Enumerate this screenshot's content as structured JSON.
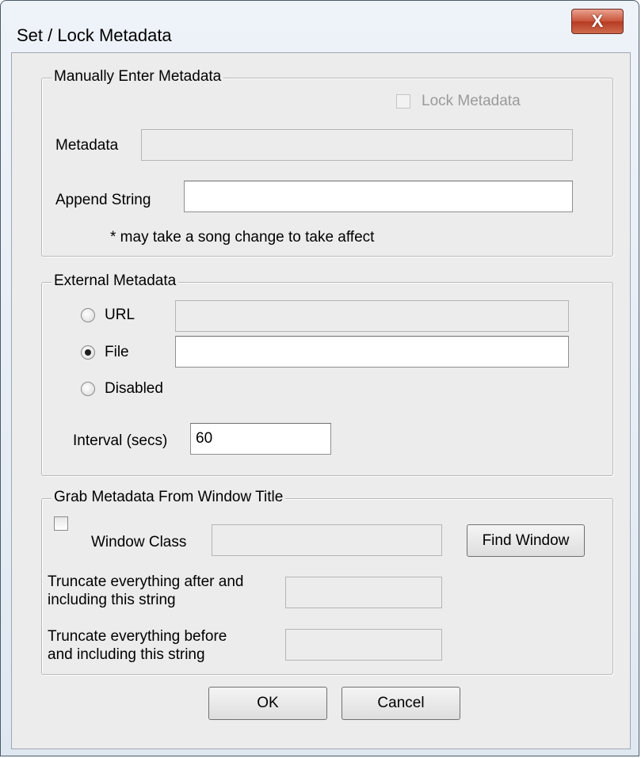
{
  "window": {
    "title": "Set / Lock Metadata",
    "close_glyph": "X"
  },
  "manual": {
    "legend": "Manually Enter Metadata",
    "lock_label": "Lock Metadata",
    "lock_checked": false,
    "lock_enabled": false,
    "metadata_label": "Metadata",
    "metadata_value": "",
    "append_label": "Append String",
    "append_value": "",
    "note": "* may take a song change to take affect"
  },
  "external": {
    "legend": "External Metadata",
    "url_label": "URL",
    "url_value": "",
    "file_label": "File",
    "file_value": "",
    "disabled_label": "Disabled",
    "selected": "File",
    "interval_label": "Interval (secs)",
    "interval_value": "60"
  },
  "grab": {
    "legend": "Grab Metadata From Window Title",
    "window_class_checked": false,
    "window_class_label": "Window Class",
    "window_class_value": "",
    "find_window_label": "Find Window",
    "truncate_after_line1": "Truncate everything after and",
    "truncate_after_line2": "including this string",
    "truncate_after_value": "",
    "truncate_before_line1": "Truncate everything before",
    "truncate_before_line2": "and including this string",
    "truncate_before_value": ""
  },
  "buttons": {
    "ok_label": "OK",
    "cancel_label": "Cancel"
  }
}
